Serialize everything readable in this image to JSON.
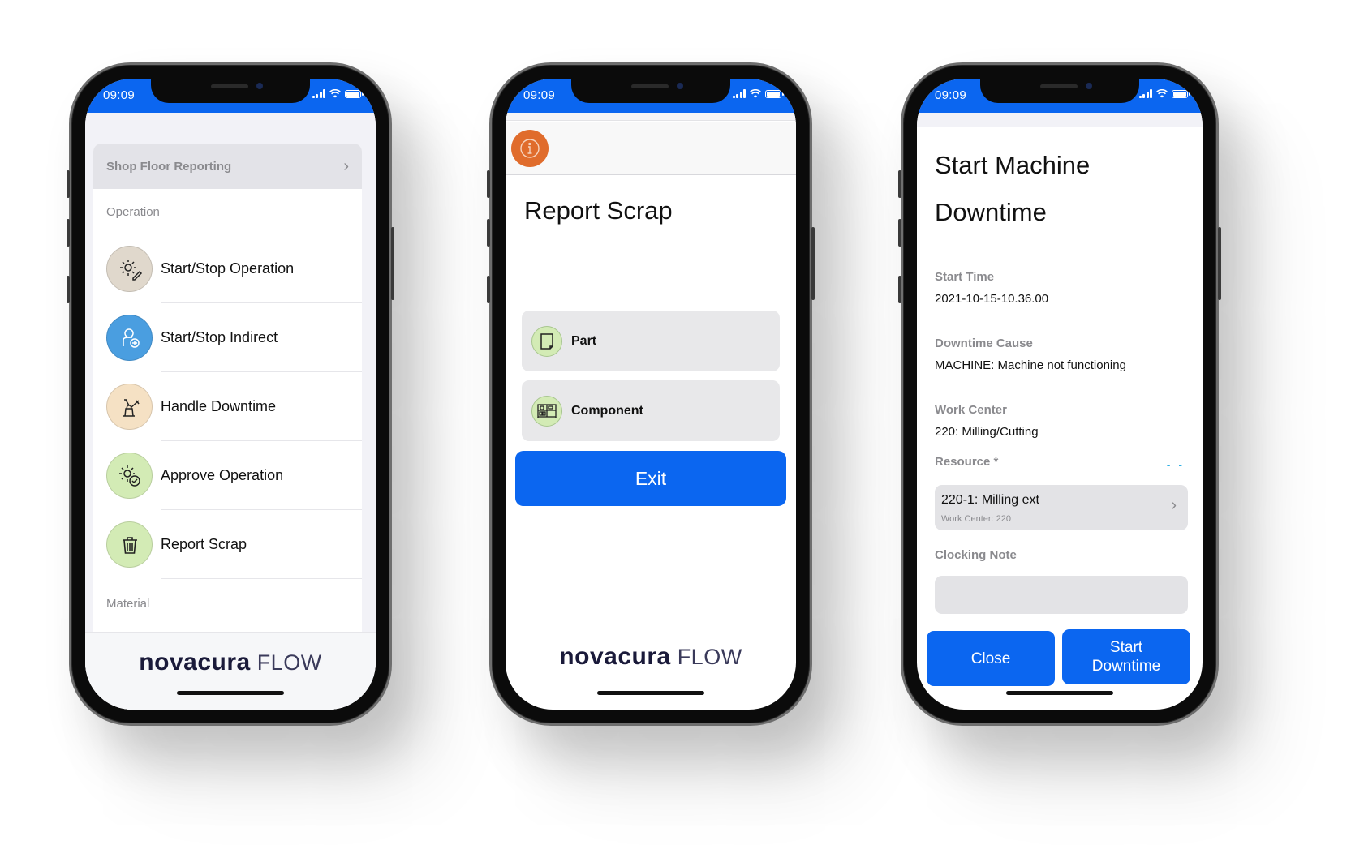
{
  "status_bar": {
    "time": "09:09"
  },
  "brand": {
    "name": "novacura",
    "product": "FLOW"
  },
  "colors": {
    "status_bar_blue": "#0b66f0",
    "primary_button": "#0b66f0",
    "info_orange": "#e06c2c",
    "icon_green": "#d3ebb5",
    "icon_beige": "#e0d8cc",
    "icon_blue": "#4a9ee0",
    "icon_peach": "#f5e1c4"
  },
  "phone1": {
    "header": {
      "title": "Shop Floor Reporting",
      "icon": "chevron-right-icon"
    },
    "sections": [
      {
        "label": "Operation",
        "items": [
          {
            "label": "Start/Stop Operation",
            "icon": "gear-pencil-icon",
            "icon_bg": "#e0d8cc"
          },
          {
            "label": "Start/Stop Indirect",
            "icon": "person-plus-icon",
            "icon_bg": "#4a9ee0"
          },
          {
            "label": "Handle Downtime",
            "icon": "oil-can-icon",
            "icon_bg": "#f5e1c4"
          },
          {
            "label": "Approve Operation",
            "icon": "gear-check-icon",
            "icon_bg": "#d3ebb5"
          },
          {
            "label": "Report Scrap",
            "icon": "trash-icon",
            "icon_bg": "#d3ebb5"
          }
        ]
      },
      {
        "label": "Material",
        "items": []
      }
    ]
  },
  "phone2": {
    "info_icon": "info-icon",
    "title": "Report Scrap",
    "options": [
      {
        "label": "Part",
        "icon": "part-icon"
      },
      {
        "label": "Component",
        "icon": "shelf-icon"
      }
    ],
    "exit_label": "Exit"
  },
  "phone3": {
    "title_line1": "Start Machine",
    "title_line2": "Downtime",
    "fields": {
      "start_time": {
        "label": "Start Time",
        "value": "2021-10-15-10.36.00"
      },
      "downtime_cause": {
        "label": "Downtime Cause",
        "value": "MACHINE: Machine not functioning"
      },
      "work_center": {
        "label": "Work Center",
        "value": "220: Milling/Cutting"
      },
      "resource": {
        "label": "Resource *",
        "value": "220-1: Milling ext",
        "subtext": "Work Center: 220",
        "indicator": "- -"
      },
      "clocking_note": {
        "label": "Clocking Note",
        "value": ""
      }
    },
    "buttons": {
      "close": "Close",
      "start_line1": "Start",
      "start_line2": "Downtime"
    }
  }
}
